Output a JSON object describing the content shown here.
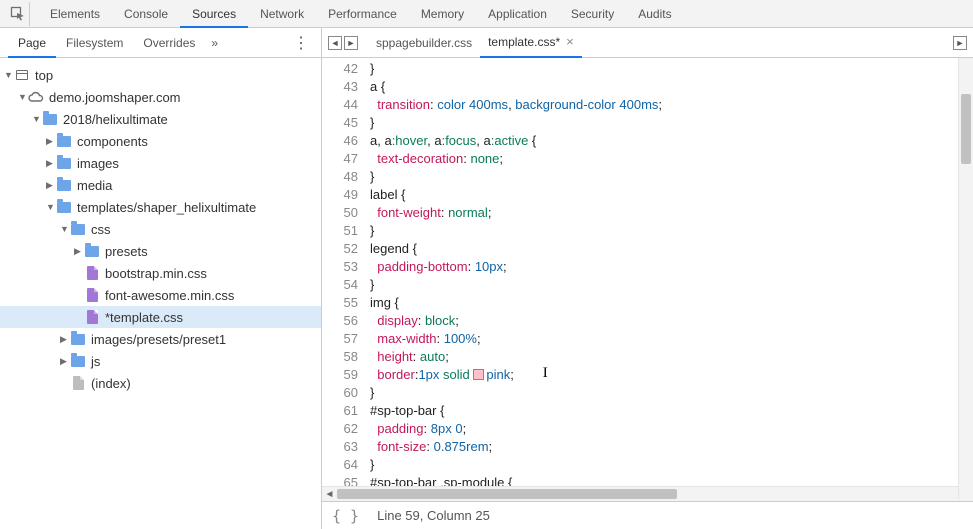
{
  "mainTabs": [
    "Elements",
    "Console",
    "Sources",
    "Network",
    "Performance",
    "Memory",
    "Application",
    "Security",
    "Audits"
  ],
  "mainTabActive": 2,
  "subTabs": [
    "Page",
    "Filesystem",
    "Overrides"
  ],
  "subTabActive": 0,
  "tree": {
    "top": "top",
    "domain": "demo.joomshaper.com",
    "path": "2018/helixultimate",
    "folders_lvl1": [
      "components",
      "images",
      "media"
    ],
    "templates_folder": "templates/shaper_helixultimate",
    "css_folder": "css",
    "presets_folder": "presets",
    "css_files": [
      "bootstrap.min.css",
      "font-awesome.min.css",
      "*template.css"
    ],
    "images_presets": "images/presets/preset1",
    "js_folder": "js",
    "index_label": "(index)"
  },
  "editorTabs": [
    {
      "label": "sppagebuilder.css",
      "close": false
    },
    {
      "label": "template.css*",
      "close": true
    }
  ],
  "editorTabActive": 1,
  "codeStart": 42,
  "code": [
    [
      [
        "sel",
        "}"
      ]
    ],
    [
      [
        "sel",
        "a {"
      ]
    ],
    [
      [
        "ind",
        "  "
      ],
      [
        "prop",
        "transition"
      ],
      [
        "sel",
        ": "
      ],
      [
        "col",
        "color"
      ],
      [
        "sel",
        " "
      ],
      [
        "num",
        "400ms"
      ],
      [
        "sel",
        ", "
      ],
      [
        "col",
        "background-color"
      ],
      [
        "sel",
        " "
      ],
      [
        "num",
        "400ms"
      ],
      [
        "sel",
        ";"
      ]
    ],
    [
      [
        "sel",
        "}"
      ]
    ],
    [
      [
        "sel",
        "a, a"
      ],
      [
        "kw",
        ":hover"
      ],
      [
        "sel",
        ", a"
      ],
      [
        "kw",
        ":focus"
      ],
      [
        "sel",
        ", a"
      ],
      [
        "kw",
        ":active"
      ],
      [
        "sel",
        " {"
      ]
    ],
    [
      [
        "ind",
        "  "
      ],
      [
        "prop",
        "text-decoration"
      ],
      [
        "sel",
        ": "
      ],
      [
        "val",
        "none"
      ],
      [
        "sel",
        ";"
      ]
    ],
    [
      [
        "sel",
        "}"
      ]
    ],
    [
      [
        "sel",
        "label {"
      ]
    ],
    [
      [
        "ind",
        "  "
      ],
      [
        "prop",
        "font-weight"
      ],
      [
        "sel",
        ": "
      ],
      [
        "val",
        "normal"
      ],
      [
        "sel",
        ";"
      ]
    ],
    [
      [
        "sel",
        "}"
      ]
    ],
    [
      [
        "sel",
        "legend {"
      ]
    ],
    [
      [
        "ind",
        "  "
      ],
      [
        "prop",
        "padding-bottom"
      ],
      [
        "sel",
        ": "
      ],
      [
        "num",
        "10px"
      ],
      [
        "sel",
        ";"
      ]
    ],
    [
      [
        "sel",
        "}"
      ]
    ],
    [
      [
        "sel",
        "img {"
      ]
    ],
    [
      [
        "ind",
        "  "
      ],
      [
        "prop",
        "display"
      ],
      [
        "sel",
        ": "
      ],
      [
        "val",
        "block"
      ],
      [
        "sel",
        ";"
      ]
    ],
    [
      [
        "ind",
        "  "
      ],
      [
        "prop",
        "max-width"
      ],
      [
        "sel",
        ": "
      ],
      [
        "num",
        "100%"
      ],
      [
        "sel",
        ";"
      ]
    ],
    [
      [
        "ind",
        "  "
      ],
      [
        "prop",
        "height"
      ],
      [
        "sel",
        ": "
      ],
      [
        "val",
        "auto"
      ],
      [
        "sel",
        ";"
      ]
    ],
    [
      [
        "ind",
        "  "
      ],
      [
        "prop",
        "border"
      ],
      [
        "sel",
        ":"
      ],
      [
        "num",
        "1px"
      ],
      [
        "sel",
        " "
      ],
      [
        "val",
        "solid"
      ],
      [
        "sel",
        " "
      ],
      [
        "swatch",
        ""
      ],
      [
        "col",
        "pink"
      ],
      [
        "sel",
        ";"
      ]
    ],
    [
      [
        "sel",
        "}"
      ]
    ],
    [
      [
        "sel",
        "#sp-top-bar {"
      ]
    ],
    [
      [
        "ind",
        "  "
      ],
      [
        "prop",
        "padding"
      ],
      [
        "sel",
        ": "
      ],
      [
        "num",
        "8px"
      ],
      [
        "sel",
        " "
      ],
      [
        "num",
        "0"
      ],
      [
        "sel",
        ";"
      ]
    ],
    [
      [
        "ind",
        "  "
      ],
      [
        "prop",
        "font-size"
      ],
      [
        "sel",
        ": "
      ],
      [
        "num",
        "0.875rem"
      ],
      [
        "sel",
        ";"
      ]
    ],
    [
      [
        "sel",
        "}"
      ]
    ],
    [
      [
        "sel",
        "#sp-top-bar .sp-module {"
      ]
    ]
  ],
  "caret": {
    "line": 59,
    "col": 25
  },
  "status": "Line 59, Column 25"
}
